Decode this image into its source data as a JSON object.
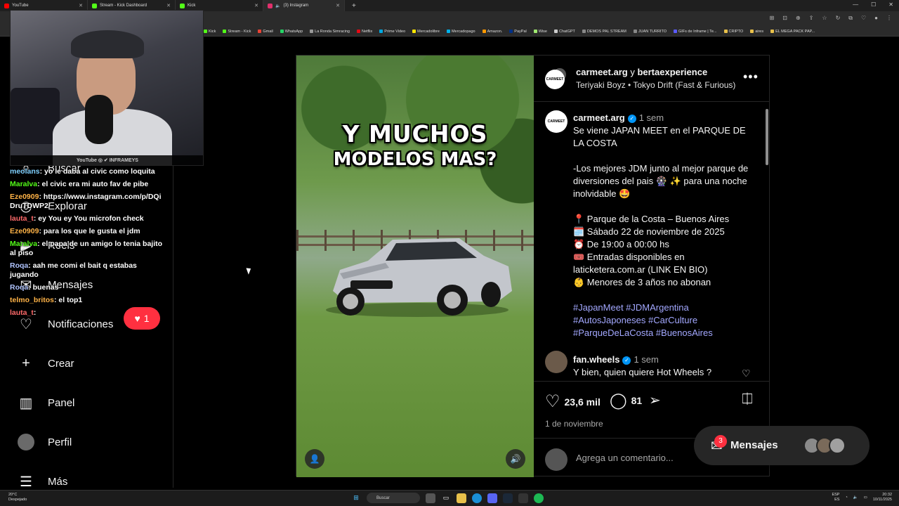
{
  "browser": {
    "tabs": [
      {
        "label": "YouTube",
        "color": "#ff0000"
      },
      {
        "label": "Stream - Kick Dashboard",
        "color": "#53fc18"
      },
      {
        "label": "Kick",
        "color": "#53fc18"
      },
      {
        "label": "(3) Instagram",
        "color": "#e1306c",
        "active": true
      }
    ],
    "bookmarks": [
      "Kick",
      "Stream - Kick",
      "Gmail",
      "WhatsApp",
      "La Ronda Simracing",
      "Netflix",
      "Prime Video",
      "Mercadolibre",
      "Mercadopago",
      "Amazon.",
      "PayPal",
      "Wise",
      "ChatGPT",
      "DEMOS PAL STREAM",
      "JUAN TURRITO",
      "GIFs de Inframe | Te...",
      "CRIPTO",
      "aires",
      "EL MEGA PACK PAP..."
    ]
  },
  "sidebar": {
    "items": [
      {
        "label": "Buscar",
        "icon": "search-icon",
        "glyph": "⌕"
      },
      {
        "label": "Explorar",
        "icon": "compass-icon",
        "glyph": "◎"
      },
      {
        "label": "Reels",
        "icon": "reels-icon",
        "glyph": "▶"
      },
      {
        "label": "Mensajes",
        "icon": "messenger-icon",
        "glyph": "✉"
      },
      {
        "label": "Notificaciones",
        "icon": "heart-icon",
        "glyph": "♡"
      },
      {
        "label": "Crear",
        "icon": "plus-icon",
        "glyph": "+"
      },
      {
        "label": "Panel",
        "icon": "dashboard-icon",
        "glyph": "▥"
      },
      {
        "label": "Perfil",
        "icon": "profile-avatar",
        "glyph": ""
      },
      {
        "label": "Más",
        "icon": "menu-icon",
        "glyph": "☰"
      }
    ],
    "notif_count": "1"
  },
  "chat": [
    {
      "user": "meolans",
      "cls": "u1",
      "msg": ": yo le daba al civic como loquita"
    },
    {
      "user": "Maralva",
      "cls": "u2",
      "msg": ": el civic era mi auto fav de pibe"
    },
    {
      "user": "Eze0909",
      "cls": "u3",
      "msg": ": https://www.instagram.com/p/DQiDruTDWP2/"
    },
    {
      "user": "lauta_t",
      "cls": "u4",
      "msg": ": ey You ey You microfon check"
    },
    {
      "user": "Eze0909",
      "cls": "u3",
      "msg": ": para los que le gusta el jdm"
    },
    {
      "user": "Maralva",
      "cls": "u2",
      "msg": ": el papa de un amigo lo tenia bajito al piso"
    },
    {
      "user": "Roqa",
      "cls": "u5",
      "msg": ": aah me comi el bait q estabas jugando"
    },
    {
      "user": "Roqa",
      "cls": "u5",
      "msg": ": buenas"
    },
    {
      "user": "telmo_britos",
      "cls": "u3",
      "msg": ": el top1"
    },
    {
      "user": "lauta_t",
      "cls": "u4",
      "msg": ":"
    }
  ],
  "webcam": {
    "socials": "YouTube  ◎  ✔  INFRAMEYS"
  },
  "post": {
    "headline_1": "Y MUCHOS",
    "headline_2": "MODELOS MAS?",
    "header": {
      "user1": "carmeet.arg",
      "joiner": " y ",
      "user2": "bertaexperience",
      "audio": "Teriyaki Boyz • Tokyo Drift (Fast & Furious)",
      "avatar_text": "CARMEET"
    },
    "caption": {
      "user": "carmeet.arg",
      "time": "1 sem",
      "text": "Se viene JAPAN MEET en el PARQUE DE LA COSTA\n\n-Los mejores JDM junto al mejor parque de diversiones del pais 🎡 ✨ para una noche inolvidable 🤩\n\n📍 Parque de la Costa – Buenos Aires\n🗓️ Sábado 22 de noviembre de 2025\n⏰ De 19:00 a 00:00 hs\n🎟️ Entradas disponibles en laticketera.com.ar (LINK EN BIO)\n👶 Menores de 3 años no abonan",
      "hashtags": "#JapanMeet #JDMArgentina #AutosJaponeses #CarCulture #ParqueDeLaCosta #BuenosAires"
    },
    "comment": {
      "user": "fan.wheels",
      "time": "1 sem",
      "text": "Y bien, quien quiere Hot Wheels ?"
    },
    "likes": "23,6 mil",
    "comments_count": "81",
    "date": "1 de noviembre",
    "comment_placeholder": "Agrega un comentario..."
  },
  "messages": {
    "label": "Mensajes",
    "badge": "3"
  },
  "taskbar": {
    "weather_temp": "20°C",
    "weather_desc": "Despejado",
    "search": "Buscar",
    "lang1": "ESP",
    "lang2": "ES",
    "time": "20:32",
    "date": "10/11/2025"
  }
}
